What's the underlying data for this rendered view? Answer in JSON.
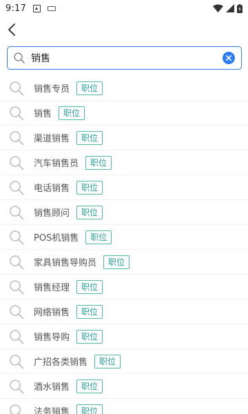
{
  "status": {
    "time": "9:17"
  },
  "search": {
    "value": "销售",
    "placeholder": ""
  },
  "suggestions": [
    {
      "text": "销售专员",
      "tag": "职位"
    },
    {
      "text": "销售",
      "tag": "职位"
    },
    {
      "text": "渠道销售",
      "tag": "职位"
    },
    {
      "text": "汽车销售员",
      "tag": "职位"
    },
    {
      "text": "电话销售",
      "tag": "职位"
    },
    {
      "text": "销售顾问",
      "tag": "职位"
    },
    {
      "text": "POS机销售",
      "tag": "职位"
    },
    {
      "text": "家具销售导购员",
      "tag": "职位"
    },
    {
      "text": "销售经理",
      "tag": "职位"
    },
    {
      "text": "网络销售",
      "tag": "职位"
    },
    {
      "text": "销售导购",
      "tag": "职位"
    },
    {
      "text": "广招各类销售",
      "tag": "职位"
    },
    {
      "text": "酒水销售",
      "tag": "职位"
    },
    {
      "text": "法务销售",
      "tag": "职位"
    }
  ],
  "icons": {
    "back": "back-arrow-icon",
    "search": "search-icon",
    "clear": "clear-icon",
    "item": "search-icon"
  },
  "colors": {
    "accent": "#2f7ef5",
    "tag": "#2aa198"
  }
}
